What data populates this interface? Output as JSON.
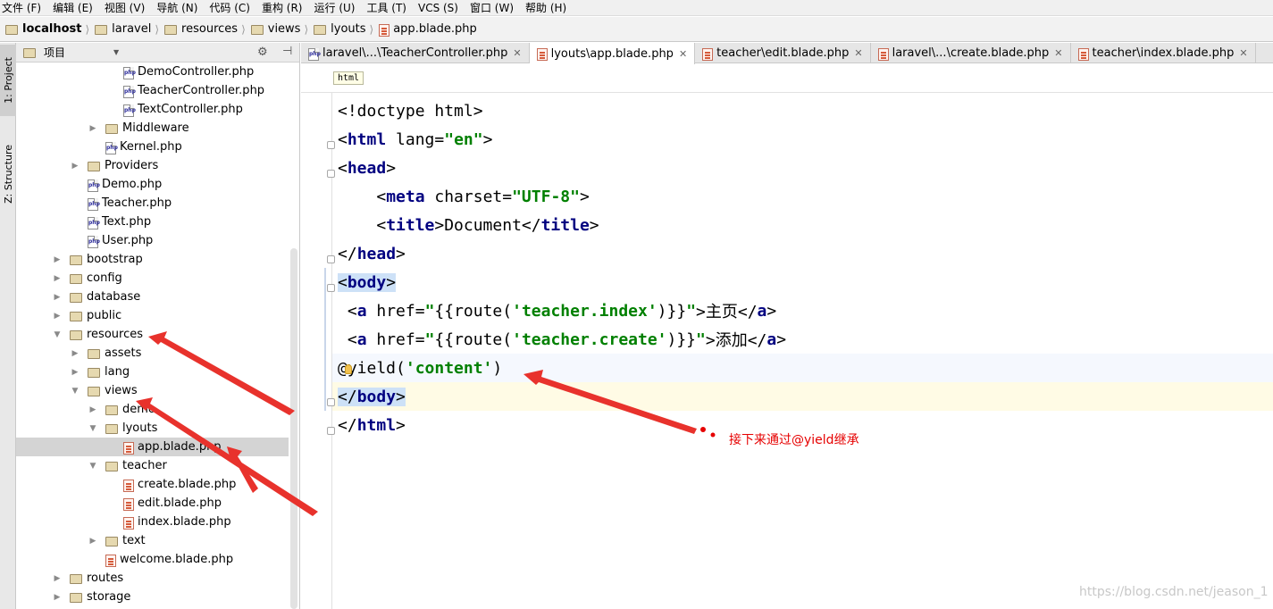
{
  "menu": [
    "文件 (F)",
    "编辑 (E)",
    "视图 (V)",
    "导航 (N)",
    "代码 (C)",
    "重构 (R)",
    "运行 (U)",
    "工具 (T)",
    "VCS (S)",
    "窗口 (W)",
    "帮助 (H)"
  ],
  "breadcrumb": [
    {
      "label": "localhost",
      "icon": "folder-icon",
      "bold": true
    },
    {
      "label": "laravel",
      "icon": "folder-icon"
    },
    {
      "label": "resources",
      "icon": "folder-icon"
    },
    {
      "label": "views",
      "icon": "folder-icon"
    },
    {
      "label": "lyouts",
      "icon": "folder-icon"
    },
    {
      "label": "app.blade.php",
      "icon": "blade-file-icon"
    }
  ],
  "tool_stripe": {
    "project": "1: Project",
    "structure": "Z: Structure"
  },
  "project_panel": {
    "header": "项目",
    "tree": [
      {
        "label": "DemoController.php",
        "type": "php",
        "indent": 5
      },
      {
        "label": "TeacherController.php",
        "type": "php",
        "indent": 5
      },
      {
        "label": "TextController.php",
        "type": "php",
        "indent": 5
      },
      {
        "label": "Middleware",
        "type": "folder",
        "indent": 4,
        "arrow": "▶"
      },
      {
        "label": "Kernel.php",
        "type": "php",
        "indent": 4
      },
      {
        "label": "Providers",
        "type": "folder",
        "indent": 3,
        "arrow": "▶"
      },
      {
        "label": "Demo.php",
        "type": "php",
        "indent": 3
      },
      {
        "label": "Teacher.php",
        "type": "php",
        "indent": 3
      },
      {
        "label": "Text.php",
        "type": "php",
        "indent": 3
      },
      {
        "label": "User.php",
        "type": "php",
        "indent": 3
      },
      {
        "label": "bootstrap",
        "type": "folder",
        "indent": 2,
        "arrow": "▶"
      },
      {
        "label": "config",
        "type": "folder",
        "indent": 2,
        "arrow": "▶"
      },
      {
        "label": "database",
        "type": "folder",
        "indent": 2,
        "arrow": "▶"
      },
      {
        "label": "public",
        "type": "folder",
        "indent": 2,
        "arrow": "▶"
      },
      {
        "label": "resources",
        "type": "folder",
        "indent": 2,
        "arrow": "▼"
      },
      {
        "label": "assets",
        "type": "folder",
        "indent": 3,
        "arrow": "▶"
      },
      {
        "label": "lang",
        "type": "folder",
        "indent": 3,
        "arrow": "▶"
      },
      {
        "label": "views",
        "type": "folder",
        "indent": 3,
        "arrow": "▼"
      },
      {
        "label": "demo",
        "type": "folder",
        "indent": 4,
        "arrow": "▶"
      },
      {
        "label": "lyouts",
        "type": "folder",
        "indent": 4,
        "arrow": "▼"
      },
      {
        "label": "app.blade.php",
        "type": "blade",
        "indent": 5,
        "selected": true
      },
      {
        "label": "teacher",
        "type": "folder",
        "indent": 4,
        "arrow": "▼"
      },
      {
        "label": "create.blade.php",
        "type": "blade",
        "indent": 5
      },
      {
        "label": "edit.blade.php",
        "type": "blade",
        "indent": 5
      },
      {
        "label": "index.blade.php",
        "type": "blade",
        "indent": 5
      },
      {
        "label": "text",
        "type": "folder",
        "indent": 4,
        "arrow": "▶"
      },
      {
        "label": "welcome.blade.php",
        "type": "blade",
        "indent": 4
      },
      {
        "label": "routes",
        "type": "folder",
        "indent": 2,
        "arrow": "▶"
      },
      {
        "label": "storage",
        "type": "folder",
        "indent": 2,
        "arrow": "▶"
      }
    ]
  },
  "editor_tabs": [
    {
      "label": "laravel\\...\\TeacherController.php",
      "icon": "php-file-icon",
      "close": "✕"
    },
    {
      "label": "lyouts\\app.blade.php",
      "icon": "blade-file-icon",
      "close": "✕",
      "active": true
    },
    {
      "label": "teacher\\edit.blade.php",
      "icon": "blade-file-icon",
      "close": "✕"
    },
    {
      "label": "laravel\\...\\create.blade.php",
      "icon": "blade-file-icon",
      "close": "✕"
    },
    {
      "label": "teacher\\index.blade.php",
      "icon": "blade-file-icon",
      "close": "✕"
    }
  ],
  "editor_breadcrumb": "html",
  "code_lines": [
    [
      {
        "t": "<!doctype html>",
        "c": "ang"
      }
    ],
    [
      {
        "t": "<",
        "c": "ang"
      },
      {
        "t": "html",
        "c": "tag"
      },
      {
        "t": " lang=",
        "c": "attr"
      },
      {
        "t": "\"en\"",
        "c": "str"
      },
      {
        "t": ">",
        "c": "ang"
      }
    ],
    [
      {
        "t": "<",
        "c": "ang"
      },
      {
        "t": "head",
        "c": "tag"
      },
      {
        "t": ">",
        "c": "ang"
      }
    ],
    [
      {
        "t": "    <",
        "c": "ang"
      },
      {
        "t": "meta",
        "c": "tag"
      },
      {
        "t": " charset=",
        "c": "attr"
      },
      {
        "t": "\"UTF-8\"",
        "c": "str"
      },
      {
        "t": ">",
        "c": "ang"
      }
    ],
    [
      {
        "t": "    <",
        "c": "ang"
      },
      {
        "t": "title",
        "c": "tag"
      },
      {
        "t": ">Document</",
        "c": "ang"
      },
      {
        "t": "title",
        "c": "tag"
      },
      {
        "t": ">",
        "c": "ang"
      }
    ],
    [
      {
        "t": "</",
        "c": "ang"
      },
      {
        "t": "head",
        "c": "tag"
      },
      {
        "t": ">",
        "c": "ang"
      }
    ],
    [
      {
        "t": "<",
        "c": "ang tagbg"
      },
      {
        "t": "body",
        "c": "tag tagbg"
      },
      {
        "t": ">",
        "c": "ang tagbg"
      }
    ],
    [
      {
        "t": " <",
        "c": "ang"
      },
      {
        "t": "a",
        "c": "tag"
      },
      {
        "t": " href=",
        "c": "attr"
      },
      {
        "t": "\"",
        "c": "str"
      },
      {
        "t": "{{route(",
        "c": "attr"
      },
      {
        "t": "'teacher.index'",
        "c": "str"
      },
      {
        "t": ")}}",
        "c": "attr"
      },
      {
        "t": "\"",
        "c": "str"
      },
      {
        "t": ">主页</",
        "c": "ang"
      },
      {
        "t": "a",
        "c": "tag"
      },
      {
        "t": ">",
        "c": "ang"
      }
    ],
    [
      {
        "t": " <",
        "c": "ang"
      },
      {
        "t": "a",
        "c": "tag"
      },
      {
        "t": " href=",
        "c": "attr"
      },
      {
        "t": "\"",
        "c": "str"
      },
      {
        "t": "{{route(",
        "c": "attr"
      },
      {
        "t": "'teacher.create'",
        "c": "str"
      },
      {
        "t": ")}}",
        "c": "attr"
      },
      {
        "t": "\"",
        "c": "str"
      },
      {
        "t": ">添加</",
        "c": "ang"
      },
      {
        "t": "a",
        "c": "tag"
      },
      {
        "t": ">",
        "c": "ang"
      }
    ],
    [
      {
        "t": "@yield(",
        "c": "attr"
      },
      {
        "t": "'content'",
        "c": "str"
      },
      {
        "t": ")",
        "c": "attr"
      }
    ],
    [
      {
        "t": "</",
        "c": "ang tagbg"
      },
      {
        "t": "body",
        "c": "tag tagbg"
      },
      {
        "t": ">",
        "c": "ang tagbg"
      }
    ],
    [
      {
        "t": "</",
        "c": "ang"
      },
      {
        "t": "html",
        "c": "tag"
      },
      {
        "t": ">",
        "c": "ang"
      }
    ]
  ],
  "annotation": "接下来通过@yield继承",
  "watermark": "https://blog.csdn.net/jeason_1",
  "colors": {
    "arrow": "#e8322c",
    "annotation": "#e60000",
    "tag": "#000080",
    "string": "#008000"
  }
}
